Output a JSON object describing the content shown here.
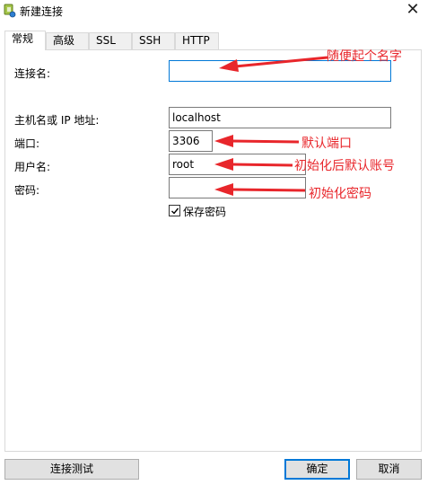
{
  "window": {
    "title": "新建连接",
    "close_glyph": "✕"
  },
  "tabs": [
    {
      "label": "常规",
      "active": true
    },
    {
      "label": "高级",
      "active": false
    },
    {
      "label": "SSL",
      "active": false
    },
    {
      "label": "SSH",
      "active": false
    },
    {
      "label": "HTTP",
      "active": false
    }
  ],
  "form": {
    "connection_name": {
      "label": "连接名:",
      "value": ""
    },
    "host": {
      "label": "主机名或 IP 地址:",
      "value": "localhost"
    },
    "port": {
      "label": "端口:",
      "value": "3306"
    },
    "username": {
      "label": "用户名:",
      "value": "root"
    },
    "password": {
      "label": "密码:",
      "value": ""
    },
    "save_password": {
      "label": "保存密码",
      "checked": true
    }
  },
  "annotations": {
    "connection_name": "随便起个名字",
    "port": "默认端口",
    "username": "初始化后默认账号",
    "password": "初始化密码",
    "color": "#e8262b"
  },
  "buttons": {
    "test": "连接测试",
    "ok": "确定",
    "cancel": "取消"
  }
}
